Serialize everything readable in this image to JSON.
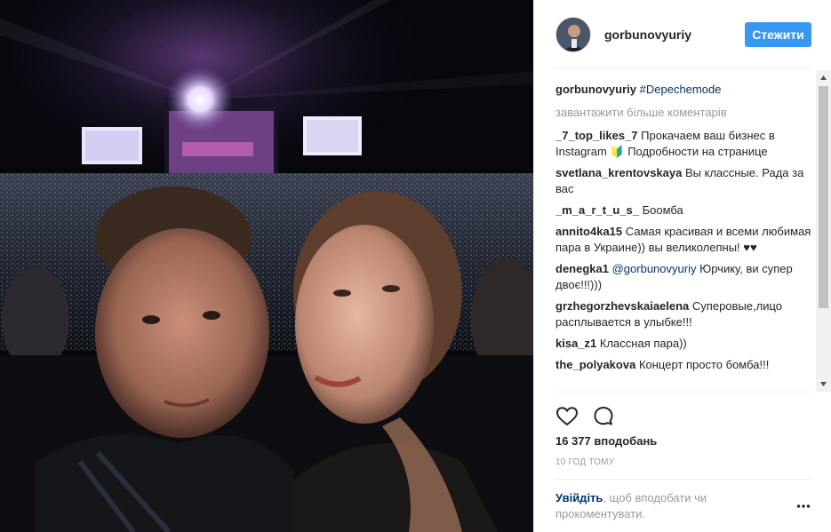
{
  "post": {
    "photo_alt": "selfie at concert",
    "header": {
      "username": "gorbunovyuriy",
      "follow_label": "Стежити"
    },
    "caption": {
      "username": "gorbunovyuriy",
      "hashtag": "#Depechemode"
    },
    "load_more_label": "завантажити більше коментарів",
    "comments": [
      {
        "user": "_7_top_likes_7",
        "text": "Прокачаем ваш бизнес в Instagram 🔰 Подробности на странице"
      },
      {
        "user": "svetlana_krentovskaya",
        "text": "Вы классные. Рада за вас"
      },
      {
        "user": "_m_a_r_t_u_s_",
        "text": "Боомба"
      },
      {
        "user": "annito4ka15",
        "text": "Самая красивая и всеми любимая пара в Украине)) вы великолепны! ♥♥"
      },
      {
        "user": "denegka1",
        "mention": "@gorbunovyuriy",
        "text": "Юрчику, ви супер двоє!!!)))"
      },
      {
        "user": "grzhegorzhevskaiaelena",
        "text": "Суперовые,лицо расплывается в улыбке!!!"
      },
      {
        "user": "kisa_z1",
        "text": "Классная пара))"
      },
      {
        "user": "the_polyakova",
        "text": "Концерт просто бомба!!!"
      }
    ],
    "likes_label": "16 377 вподобань",
    "time_label": "10 ГОД ТОМУ",
    "login_prompt": {
      "link": "Увійдіть",
      "rest": ", щоб вподобати чи прокоментувати."
    },
    "icons": {
      "like": "heart-icon",
      "comment": "comment-bubble-icon",
      "more": "more-options-icon"
    },
    "colors": {
      "accent": "#3897f0",
      "link": "#003569",
      "muted": "#999999",
      "text": "#262626"
    }
  }
}
